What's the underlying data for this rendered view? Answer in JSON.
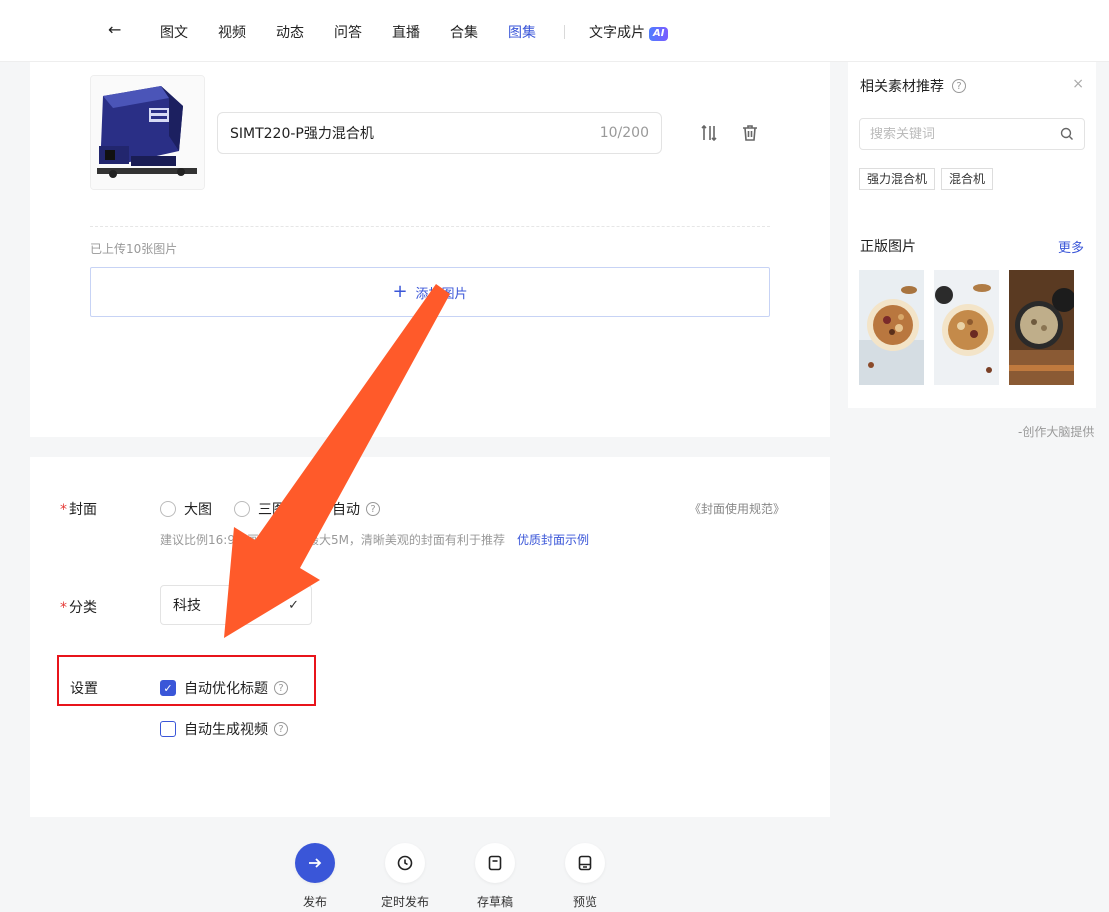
{
  "nav": {
    "tabs": [
      "图文",
      "视频",
      "动态",
      "问答",
      "直播",
      "合集",
      "图集"
    ],
    "active_tab": "图集",
    "ai_tab_label": "文字成片",
    "ai_badge": "AI"
  },
  "image_editor": {
    "title_value": "SIMT220-P强力混合机",
    "title_count": "10/200",
    "uploaded_text": "已上传10张图片",
    "add_image_label": "添加图片"
  },
  "cover": {
    "label": "封面",
    "options": [
      "大图",
      "三图",
      "自动"
    ],
    "rule_link": "《封面使用规范》",
    "hint": "建议比例16:9，画面清晰，最大5M，清晰美观的封面有利于推荐",
    "example_link": "优质封面示例"
  },
  "category": {
    "label": "分类",
    "value": "科技"
  },
  "settings": {
    "label": "设置",
    "auto_title_label": "自动优化标题",
    "auto_title_checked": true,
    "auto_video_label": "自动生成视频",
    "auto_video_checked": false
  },
  "actions": {
    "publish": "发布",
    "schedule": "定时发布",
    "draft": "存草稿",
    "preview": "预览"
  },
  "sidebar": {
    "title": "相关素材推荐",
    "search_placeholder": "搜索关键词",
    "tags": [
      "强力混合机",
      "混合机"
    ],
    "subtitle": "正版图片",
    "more": "更多",
    "credit": "-创作大脑提供"
  },
  "colors": {
    "accent": "#3a56d8",
    "required": "#e53935",
    "highlight_box": "#e8141b",
    "arrow": "#ff5a2a"
  }
}
